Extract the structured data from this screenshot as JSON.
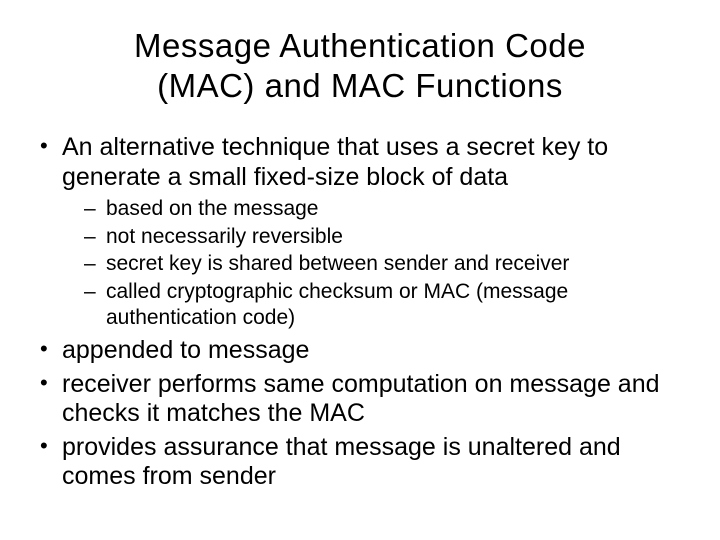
{
  "title_line1": "Message Authentication Code",
  "title_line2": "(MAC) and MAC Functions",
  "bullets": {
    "b1": "An alternative technique that uses a secret key to generate a small fixed-size block of data",
    "sub": {
      "s1": "based on the message",
      "s2": "not necessarily reversible",
      "s3": "secret key is shared between sender and receiver",
      "s4": "called cryptographic checksum or MAC (message authentication code)"
    },
    "b2": "appended to message",
    "b3": "receiver performs same computation on message and checks it matches the MAC",
    "b4": "provides assurance that message is unaltered and comes from sender"
  }
}
